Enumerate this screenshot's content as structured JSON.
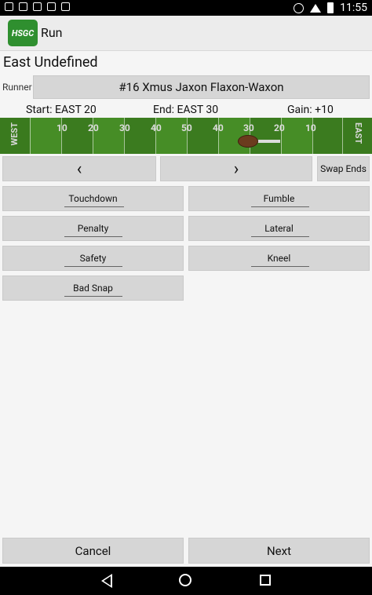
{
  "status": {
    "time": "11:55"
  },
  "app": {
    "title": "Run",
    "logo_text": "HSGC"
  },
  "team": "East Undefined",
  "runner": {
    "label": "Runner",
    "value": "#16 Xmus Jaxon Flaxon-Waxon"
  },
  "play": {
    "start": "Start: EAST 20",
    "end": "End: EAST 30",
    "gain": "Gain: +10"
  },
  "field": {
    "endzone_left": "WEST",
    "endzone_right": "EAST",
    "yards": [
      "10",
      "20",
      "30",
      "40",
      "50",
      "40",
      "30",
      "20",
      "10"
    ]
  },
  "controls": {
    "prev": "‹",
    "next": "›",
    "swap": "Swap Ends"
  },
  "results": [
    "Touchdown",
    "Fumble",
    "Penalty",
    "Lateral",
    "Safety",
    "Kneel",
    "Bad Snap"
  ],
  "footer": {
    "cancel": "Cancel",
    "next": "Next"
  }
}
